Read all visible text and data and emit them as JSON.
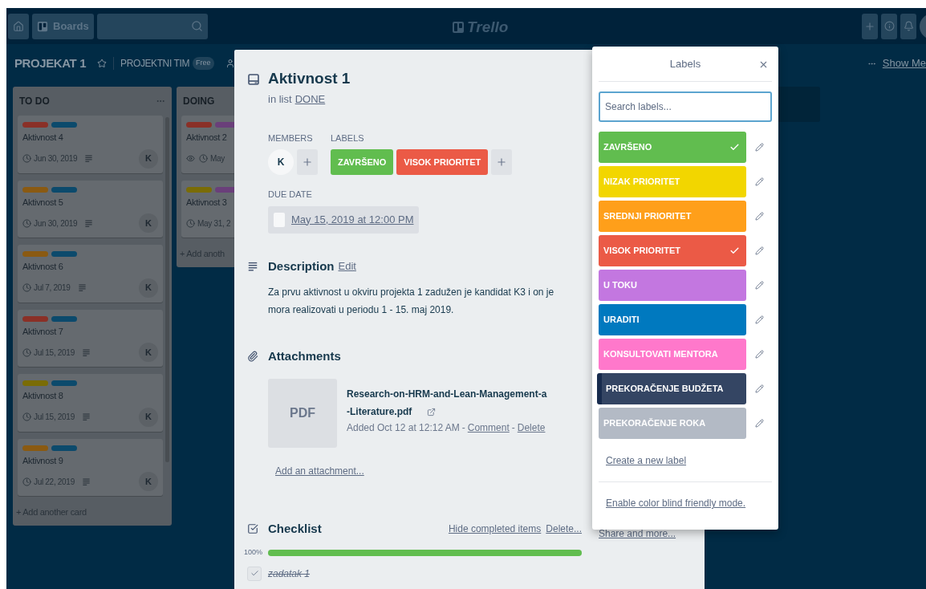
{
  "top_bar": {
    "boards_button": "Boards",
    "logo": "Trello"
  },
  "board": {
    "title": "PROJEKAT 1",
    "starred": false,
    "team": "PROJEKTNI TIM",
    "team_plan": "Free",
    "menu_link": "Show Me"
  },
  "lists": [
    {
      "title": "TO DO",
      "cards": [
        {
          "title": "Aktivnost 4",
          "labels": [
            {
              "color": "#8a3027"
            },
            {
              "color": "#0c4a6c"
            }
          ],
          "watching": false,
          "due": "Jun 30, 2019",
          "has_description": true,
          "member": "K"
        },
        {
          "title": "Aktivnost 5",
          "labels": [
            {
              "color": "#8a5a12"
            },
            {
              "color": "#0c4a6c"
            }
          ],
          "watching": false,
          "due": "Jun 30, 2019",
          "has_description": true,
          "member": "K"
        },
        {
          "title": "Aktivnost 6",
          "labels": [
            {
              "color": "#8a5a12"
            },
            {
              "color": "#0c4a6c"
            }
          ],
          "watching": false,
          "due": "Jul 7, 2019",
          "has_description": true,
          "member": "K"
        },
        {
          "title": "Aktivnost 7",
          "labels": [
            {
              "color": "#8a3027"
            },
            {
              "color": "#0c4a6c"
            }
          ],
          "watching": false,
          "due": "Jul 15, 2019",
          "has_description": true,
          "member": "K"
        },
        {
          "title": "Aktivnost 8",
          "labels": [
            {
              "color": "#7a6c06"
            },
            {
              "color": "#0c4a6c"
            }
          ],
          "watching": false,
          "due": "Jul 15, 2019",
          "has_description": true,
          "member": "K"
        },
        {
          "title": "Aktivnost 9",
          "labels": [
            {
              "color": "#8a5a12"
            },
            {
              "color": "#0c4a6c"
            }
          ],
          "watching": false,
          "due": "Jul 22, 2019",
          "has_description": true,
          "member": "K"
        }
      ],
      "add_card": "+ Add another card"
    },
    {
      "title": "DOING",
      "cards": [
        {
          "title": "Aktivnost 2",
          "labels": [
            {
              "color": "#8a3027"
            },
            {
              "color": "#6a3f7a"
            }
          ],
          "watching": true,
          "due": "May"
        },
        {
          "title": "Aktivnost 3",
          "labels": [
            {
              "color": "#7a6c06"
            },
            {
              "color": "#6a3f7a"
            }
          ],
          "watching": false,
          "due": "May 31, 2"
        }
      ],
      "add_card": "+ Add anoth"
    }
  ],
  "card_modal": {
    "title": "Aktivnost 1",
    "list_prefix": "in list",
    "list_name": "DONE",
    "members_heading": "MEMBERS",
    "members": [
      {
        "initial": "K"
      }
    ],
    "labels_heading": "LABELS",
    "labels": [
      {
        "name": "ZAVRŠENO",
        "color": "#61bd4f"
      },
      {
        "name": "VISOK PRIORITET",
        "color": "#eb5a46"
      }
    ],
    "due_heading": "DUE DATE",
    "due": {
      "text": "May 15, 2019 at 12:00 PM",
      "complete": false
    },
    "description": {
      "heading": "Description",
      "edit": "Edit",
      "text": "Za prvu aktivnost u okviru projekta 1 zadužen je kandidat K3 i on je mora realizovati u periodu 1 - 15. maj 2019."
    },
    "attachments": {
      "heading": "Attachments",
      "items": [
        {
          "thumb": "PDF",
          "name": "Research-on-HRM-and-Lean-Management-a-Literature.pdf",
          "added": "Added Oct 12 at 12:12 AM",
          "separator": "-",
          "actions": [
            "Comment",
            "Delete"
          ]
        }
      ],
      "add": "Add an attachment..."
    },
    "checklist": {
      "heading": "Checklist",
      "actions": [
        "Hide completed items",
        "Delete..."
      ],
      "percent": "100%",
      "level": 1,
      "items": [
        {
          "text": "zadatak 1",
          "checked": true
        }
      ]
    },
    "sidebar_link": "Share and more..."
  },
  "labels_popover": {
    "title": "Labels",
    "search_placeholder": "Search labels...",
    "labels": [
      {
        "name": "ZAVRŠENO",
        "color": "#61bd4f",
        "checked": true,
        "focused": false
      },
      {
        "name": "NIZAK PRIORITET",
        "color": "#f2d600",
        "checked": false,
        "focused": false
      },
      {
        "name": "SREDNJI PRIORITET",
        "color": "#ff9f1a",
        "checked": false,
        "focused": false
      },
      {
        "name": "VISOK PRIORITET",
        "color": "#eb5a46",
        "checked": true,
        "focused": false
      },
      {
        "name": "U TOKU",
        "color": "#c377e0",
        "checked": false,
        "focused": false
      },
      {
        "name": "URADITI",
        "color": "#0079bf",
        "checked": false,
        "focused": false
      },
      {
        "name": "KONSULTOVATI MENTORA",
        "color": "#ff78cb",
        "checked": false,
        "focused": false
      },
      {
        "name": "PREKORAČENJE BUDŽETA",
        "color": "#344563",
        "checked": false,
        "focused": true
      },
      {
        "name": "PREKORAČENJE ROKA",
        "color": "#b3bac5",
        "checked": false,
        "focused": false
      }
    ],
    "create_link": "Create a new label",
    "colorblind_link": "Enable color blind friendly mode."
  }
}
